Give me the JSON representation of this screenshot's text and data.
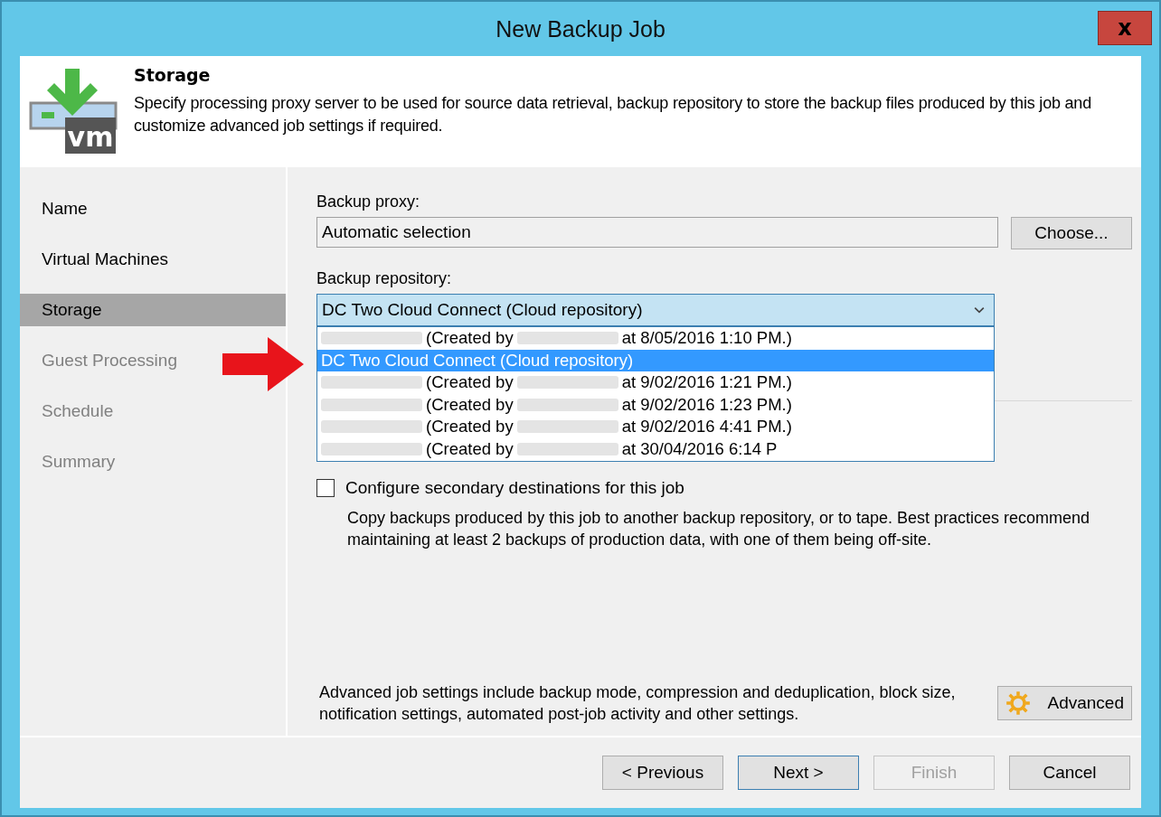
{
  "window": {
    "title": "New Backup Job",
    "close": "x"
  },
  "header": {
    "logo_text": "vm",
    "title": "Storage",
    "description": "Specify processing proxy server to be used for source data retrieval, backup repository to store the backup files produced by this job and customize advanced job settings if required."
  },
  "steps": [
    {
      "label": "Name",
      "selected": false,
      "disabled": false
    },
    {
      "label": "Virtual Machines",
      "selected": false,
      "disabled": false
    },
    {
      "label": "Storage",
      "selected": true,
      "disabled": false
    },
    {
      "label": "Guest Processing",
      "selected": false,
      "disabled": true
    },
    {
      "label": "Schedule",
      "selected": false,
      "disabled": true
    },
    {
      "label": "Summary",
      "selected": false,
      "disabled": true
    }
  ],
  "proxy": {
    "label": "Backup proxy:",
    "value": "Automatic selection",
    "button": "Choose..."
  },
  "repository": {
    "label": "Backup repository:",
    "value": "DC Two Cloud Connect (Cloud repository)",
    "expanded": true,
    "options": [
      {
        "selected": false,
        "parts": [
          {
            "kind": "redacted"
          },
          {
            "kind": "text",
            "text": "(Created by"
          },
          {
            "kind": "redacted"
          },
          {
            "kind": "text",
            "text": "at 8/05/2016 1:10 PM.)"
          }
        ]
      },
      {
        "selected": true,
        "parts": [
          {
            "kind": "text",
            "text": "DC Two Cloud Connect (Cloud repository)"
          }
        ]
      },
      {
        "selected": false,
        "parts": [
          {
            "kind": "redacted"
          },
          {
            "kind": "text",
            "text": "(Created by"
          },
          {
            "kind": "redacted"
          },
          {
            "kind": "text",
            "text": "at 9/02/2016 1:21 PM.)"
          }
        ]
      },
      {
        "selected": false,
        "parts": [
          {
            "kind": "redacted"
          },
          {
            "kind": "text",
            "text": "(Created by"
          },
          {
            "kind": "redacted"
          },
          {
            "kind": "text",
            "text": "at 9/02/2016 1:23 PM.)"
          }
        ]
      },
      {
        "selected": false,
        "parts": [
          {
            "kind": "redacted"
          },
          {
            "kind": "text",
            "text": "(Created by"
          },
          {
            "kind": "redacted"
          },
          {
            "kind": "text",
            "text": "at 9/02/2016 4:41 PM.)"
          }
        ]
      },
      {
        "selected": false,
        "parts": [
          {
            "kind": "redacted"
          },
          {
            "kind": "text",
            "text": "(Created by"
          },
          {
            "kind": "redacted"
          },
          {
            "kind": "text",
            "text": "at 30/04/2016 6:14 P"
          }
        ]
      }
    ]
  },
  "secondary": {
    "label": "Configure secondary destinations for this job",
    "checked": false,
    "description": "Copy backups produced by this job to another backup repository, or to tape. Best practices recommend maintaining at least 2 backups of production data, with one of them being off-site."
  },
  "advanced": {
    "description": "Advanced job settings include backup mode, compression and deduplication, block size, notification settings, automated post-job activity and other settings.",
    "button": "Advanced"
  },
  "buttons": [
    {
      "label": "< Previous",
      "disabled": false,
      "default": false
    },
    {
      "label": "Next >",
      "disabled": false,
      "default": true
    },
    {
      "label": "Finish",
      "disabled": true,
      "default": false
    },
    {
      "label": "Cancel",
      "disabled": false,
      "default": false
    }
  ]
}
